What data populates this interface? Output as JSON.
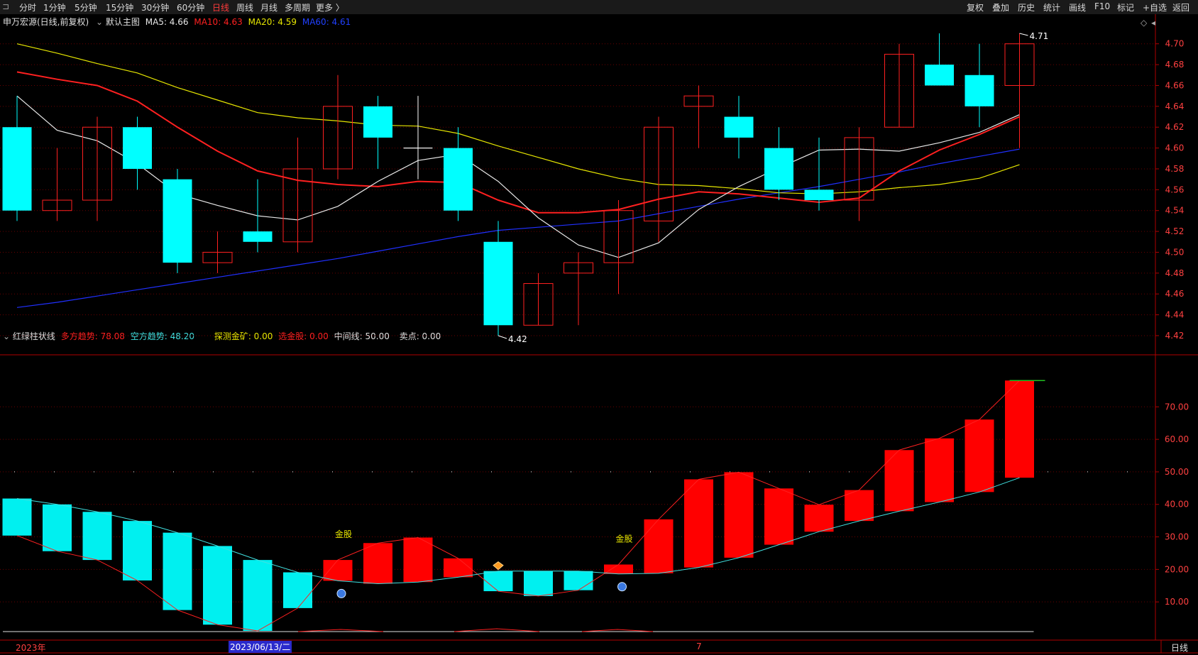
{
  "toolbar": {
    "left_icon": "window-icon",
    "periods": [
      "分时",
      "1分钟",
      "5分钟",
      "15分钟",
      "30分钟",
      "60分钟",
      "日线",
      "周线",
      "月线",
      "多周期",
      "更多 〉"
    ],
    "active_period": "日线",
    "right_tools": [
      "复权",
      "叠加",
      "历史",
      "统计",
      "画线",
      "F10",
      "标记",
      "+自选",
      "返回"
    ]
  },
  "main_legend": {
    "stock": "申万宏源(日线,前复权)",
    "template": "默认主图",
    "ma5": "MA5: 4.66",
    "ma10": "MA10: 4.63",
    "ma20": "MA20: 4.59",
    "ma60": "MA60: 4.61"
  },
  "sub_legend": {
    "name": "红绿柱状线",
    "bull": "多方趋势: 78.08",
    "bear": "空方趋势: 48.20",
    "probe": "探测金矿: 0.00",
    "select": "选金股: 0.00",
    "mid": "中间线: 50.00",
    "sell": "卖点: 0.00"
  },
  "colors": {
    "up": "#ff2020",
    "down": "#00ffff",
    "ma5": "#e8e8e8",
    "ma10": "#ff2020",
    "ma20": "#e6e600",
    "ma60": "#2030ff",
    "axis": "#b00000",
    "grid": "#6a0000",
    "yellow": "#e6e600",
    "cyan": "#40e0e0"
  },
  "chart_data": [
    {
      "type": "candlestick",
      "title": "申万宏源(日线,前复权)",
      "ylim": [
        4.405,
        4.725
      ],
      "yticks": [
        "4.70",
        "4.68",
        "4.66",
        "4.64",
        "4.62",
        "4.60",
        "4.58",
        "4.56",
        "4.54",
        "4.52",
        "4.50",
        "4.48",
        "4.46",
        "4.44",
        "4.42"
      ],
      "candles": [
        {
          "o": 4.62,
          "c": 4.54,
          "h": 4.65,
          "l": 4.53
        },
        {
          "o": 4.54,
          "c": 4.55,
          "h": 4.6,
          "l": 4.53
        },
        {
          "o": 4.55,
          "c": 4.62,
          "h": 4.63,
          "l": 4.53
        },
        {
          "o": 4.62,
          "c": 4.58,
          "h": 4.63,
          "l": 4.56
        },
        {
          "o": 4.57,
          "c": 4.49,
          "h": 4.58,
          "l": 4.48
        },
        {
          "o": 4.49,
          "c": 4.5,
          "h": 4.52,
          "l": 4.48
        },
        {
          "o": 4.52,
          "c": 4.51,
          "h": 4.57,
          "l": 4.5
        },
        {
          "o": 4.51,
          "c": 4.58,
          "h": 4.61,
          "l": 4.5
        },
        {
          "o": 4.58,
          "c": 4.64,
          "h": 4.67,
          "l": 4.57
        },
        {
          "o": 4.64,
          "c": 4.61,
          "h": 4.65,
          "l": 4.58
        },
        {
          "o": 4.6,
          "c": 4.6,
          "h": 4.65,
          "l": 4.57
        },
        {
          "o": 4.6,
          "c": 4.54,
          "h": 4.62,
          "l": 4.53
        },
        {
          "o": 4.51,
          "c": 4.43,
          "h": 4.53,
          "l": 4.42
        },
        {
          "o": 4.43,
          "c": 4.47,
          "h": 4.48,
          "l": 4.43
        },
        {
          "o": 4.48,
          "c": 4.49,
          "h": 4.5,
          "l": 4.43
        },
        {
          "o": 4.49,
          "c": 4.54,
          "h": 4.55,
          "l": 4.46
        },
        {
          "o": 4.53,
          "c": 4.62,
          "h": 4.63,
          "l": 4.51
        },
        {
          "o": 4.64,
          "c": 4.65,
          "h": 4.66,
          "l": 4.6
        },
        {
          "o": 4.63,
          "c": 4.61,
          "h": 4.65,
          "l": 4.59
        },
        {
          "o": 4.6,
          "c": 4.56,
          "h": 4.62,
          "l": 4.55
        },
        {
          "o": 4.56,
          "c": 4.55,
          "h": 4.61,
          "l": 4.54
        },
        {
          "o": 4.55,
          "c": 4.61,
          "h": 4.62,
          "l": 4.53
        },
        {
          "o": 4.62,
          "c": 4.69,
          "h": 4.7,
          "l": 4.62
        },
        {
          "o": 4.68,
          "c": 4.66,
          "h": 4.71,
          "l": 4.66
        },
        {
          "o": 4.67,
          "c": 4.64,
          "h": 4.7,
          "l": 4.62
        },
        {
          "o": 4.66,
          "c": 4.7,
          "h": 4.71,
          "l": 4.6
        }
      ],
      "ma5": [
        4.65,
        4.617,
        4.607,
        4.585,
        4.556,
        4.545,
        4.535,
        4.531,
        4.544,
        4.568,
        4.588,
        4.594,
        4.568,
        4.533,
        4.507,
        4.495,
        4.509,
        4.541,
        4.563,
        4.581,
        4.598,
        4.599,
        4.597,
        4.605,
        4.615,
        4.632,
        4.66
      ],
      "ma10": [
        4.673,
        4.666,
        4.66,
        4.645,
        4.62,
        4.597,
        4.578,
        4.569,
        4.565,
        4.563,
        4.568,
        4.567,
        4.55,
        4.538,
        4.538,
        4.541,
        4.551,
        4.558,
        4.556,
        4.552,
        4.548,
        4.552,
        4.578,
        4.598,
        4.613,
        4.63
      ],
      "ma20": [
        4.7,
        4.691,
        4.681,
        4.672,
        4.658,
        4.646,
        4.634,
        4.629,
        4.626,
        4.622,
        4.621,
        4.614,
        4.602,
        4.591,
        4.58,
        4.571,
        4.565,
        4.564,
        4.561,
        4.557,
        4.556,
        4.558,
        4.562,
        4.565,
        4.571,
        4.584
      ],
      "ma60": [
        4.447,
        4.452,
        4.458,
        4.464,
        4.47,
        4.476,
        4.482,
        4.488,
        4.494,
        4.501,
        4.508,
        4.515,
        4.521,
        4.524,
        4.527,
        4.53,
        4.537,
        4.544,
        4.551,
        4.557,
        4.563,
        4.57,
        4.577,
        4.585,
        4.592,
        4.599,
        4.608
      ],
      "annotations": {
        "high": "4.71",
        "low": "4.42"
      }
    },
    {
      "type": "bar",
      "title": "红绿柱状线",
      "ylim": [
        0,
        81.2
      ],
      "yticks": [
        "70.00",
        "60.00",
        "50.00",
        "40.00",
        "30.00",
        "20.00",
        "10.00"
      ],
      "bars": [
        {
          "lo": 30.4,
          "hi": 41.8,
          "up": false
        },
        {
          "lo": 25.6,
          "hi": 40.0,
          "up": false
        },
        {
          "lo": 22.9,
          "hi": 37.7,
          "up": false
        },
        {
          "lo": 16.6,
          "hi": 34.9,
          "up": false
        },
        {
          "lo": 7.5,
          "hi": 31.3,
          "up": false
        },
        {
          "lo": 3.0,
          "hi": 27.2,
          "up": false
        },
        {
          "lo": 1.1,
          "hi": 22.9,
          "up": false
        },
        {
          "lo": 8.1,
          "hi": 19.1,
          "up": false
        },
        {
          "lo": 16.5,
          "hi": 22.9,
          "up": true
        },
        {
          "lo": 15.6,
          "hi": 28.1,
          "up": true
        },
        {
          "lo": 16.1,
          "hi": 29.8,
          "up": true
        },
        {
          "lo": 17.6,
          "hi": 23.4,
          "up": true
        },
        {
          "lo": 13.3,
          "hi": 19.5,
          "up": false
        },
        {
          "lo": 11.8,
          "hi": 19.5,
          "up": false
        },
        {
          "lo": 13.6,
          "hi": 19.5,
          "up": false
        },
        {
          "lo": 18.6,
          "hi": 21.5,
          "up": true
        },
        {
          "lo": 18.8,
          "hi": 35.4,
          "up": true
        },
        {
          "lo": 20.6,
          "hi": 47.7,
          "up": true
        },
        {
          "lo": 23.6,
          "hi": 49.9,
          "up": true
        },
        {
          "lo": 27.6,
          "hi": 44.9,
          "up": true
        },
        {
          "lo": 31.6,
          "hi": 39.9,
          "up": true
        },
        {
          "lo": 34.9,
          "hi": 44.4,
          "up": true
        },
        {
          "lo": 37.9,
          "hi": 56.7,
          "up": true
        },
        {
          "lo": 40.7,
          "hi": 60.3,
          "up": true
        },
        {
          "lo": 43.8,
          "hi": 66.1,
          "up": true
        },
        {
          "lo": 48.2,
          "hi": 78.1,
          "up": true
        }
      ],
      "mid_line": 50,
      "markers": [
        {
          "index": 8,
          "label": "金股"
        },
        {
          "index": 15,
          "label": "金股"
        }
      ],
      "diamond_index": 12
    }
  ],
  "timeline": {
    "start": "2023年",
    "cursor": "2023/06/13/二",
    "month": "7",
    "period": "日线"
  }
}
